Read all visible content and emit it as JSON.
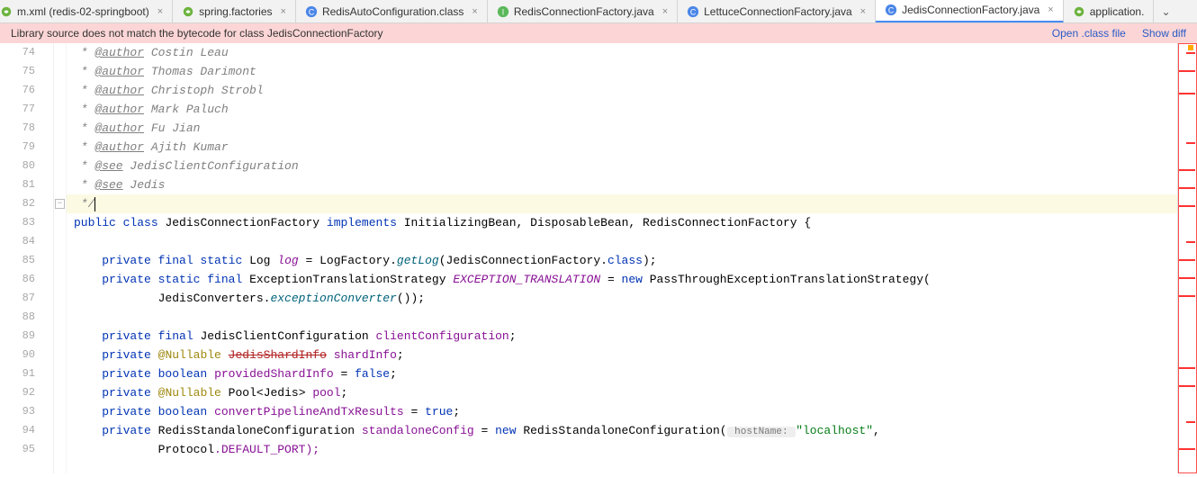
{
  "tabs": {
    "items": [
      {
        "label": "m.xml (redis-02-springboot)",
        "icon": "spring",
        "close": true,
        "selected": false,
        "cut": true
      },
      {
        "label": "spring.factories",
        "icon": "spring",
        "close": true,
        "selected": false
      },
      {
        "label": "RedisAutoConfiguration.class",
        "icon": "class",
        "close": true,
        "selected": false
      },
      {
        "label": "RedisConnectionFactory.java",
        "icon": "interface",
        "close": true,
        "selected": false
      },
      {
        "label": "LettuceConnectionFactory.java",
        "icon": "class",
        "close": true,
        "selected": false
      },
      {
        "label": "JedisConnectionFactory.java",
        "icon": "class",
        "close": true,
        "selected": true
      },
      {
        "label": "application.",
        "icon": "spring",
        "close": false,
        "selected": false,
        "cutRight": true
      }
    ],
    "more": "⌄"
  },
  "banner": {
    "message": "Library source does not match the bytecode for class JedisConnectionFactory",
    "openClass": "Open .class file",
    "showDiff": "Show diff"
  },
  "gutter": {
    "start": 74,
    "count": 22
  },
  "code": {
    "l74": {
      "pre": " * ",
      "tag": "@author",
      "rest": " Costin Leau"
    },
    "l75": {
      "pre": " * ",
      "tag": "@author",
      "rest": " Thomas Darimont"
    },
    "l76": {
      "pre": " * ",
      "tag": "@author",
      "rest": " Christoph Strobl"
    },
    "l77": {
      "pre": " * ",
      "tag": "@author",
      "rest": " Mark Paluch"
    },
    "l78": {
      "pre": " * ",
      "tag": "@author",
      "rest": " Fu Jian"
    },
    "l79": {
      "pre": " * ",
      "tag": "@author",
      "rest": " Ajith Kumar"
    },
    "l80": {
      "pre": " * ",
      "tag": "@see",
      "rest": " JedisClientConfiguration"
    },
    "l81": {
      "pre": " * ",
      "tag": "@see",
      "rest": " Jedis"
    },
    "l82": {
      "text": " */"
    },
    "l83": {
      "kw1": "public",
      "kw2": "class",
      "name": "JedisConnectionFactory",
      "kw3": "implements",
      "ifaces": "InitializingBean, DisposableBean, RedisConnectionFactory {"
    },
    "l85": {
      "kw": "private final static",
      "type": "Log",
      "field": "log",
      "eq": " = LogFactory.",
      "call": "getLog",
      "arg": "(JedisConnectionFactory.",
      "cls": "class",
      "end": ");"
    },
    "l86": {
      "kw": "private static final",
      "type": "ExceptionTranslationStrategy",
      "field": "EXCEPTION_TRANSLATION",
      "eq": " = ",
      "nw": "new",
      "ctor": " PassThroughExceptionTranslationStrategy("
    },
    "l87": {
      "pre": "            JedisConverters.",
      "call": "exceptionConverter",
      "end": "());"
    },
    "l89": {
      "kw": "private final",
      "type": "JedisClientConfiguration",
      "field": "clientConfiguration",
      "end": ";"
    },
    "l90": {
      "kw": "private",
      "anno": "@Nullable",
      "type": "JedisShardInfo",
      "field": "shardInfo",
      "end": ";",
      "deprecated": true
    },
    "l91": {
      "kw": "private boolean",
      "field": "providedShardInfo",
      "eq": " = ",
      "val": "false",
      "end": ";"
    },
    "l92": {
      "kw": "private",
      "anno": "@Nullable",
      "type": "Pool",
      "gen": "<Jedis>",
      "field": "pool",
      "end": ";"
    },
    "l93": {
      "kw": "private boolean",
      "field": "convertPipelineAndTxResults",
      "eq": " = ",
      "val": "true",
      "end": ";"
    },
    "l94": {
      "kw": "private",
      "type": "RedisStandaloneConfiguration",
      "field": "standaloneConfig",
      "eq": " = ",
      "nw": "new",
      "ctor": " RedisStandaloneConfiguration(",
      "hint": " hostName: ",
      "str": "\"localhost\"",
      "comma": ","
    },
    "l95": {
      "pre": "            ",
      "type": "Protocol",
      "cst": ".DEFAULT_PORT);"
    }
  },
  "rail": {
    "markers": [
      10,
      30,
      55,
      110,
      140,
      160,
      180,
      220,
      240,
      260,
      280,
      360,
      380,
      420,
      450
    ]
  }
}
